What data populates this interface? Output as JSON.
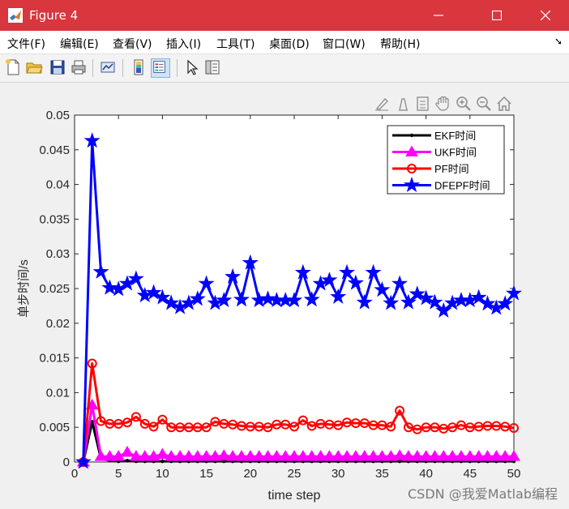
{
  "window": {
    "title": "Figure 4",
    "accent": "#d9363e",
    "controls": [
      "minimize-icon",
      "maximize-icon",
      "close-icon"
    ]
  },
  "menu": [
    "文件(F)",
    "编辑(E)",
    "查看(V)",
    "插入(I)",
    "工具(T)",
    "桌面(D)",
    "窗口(W)",
    "帮助(H)"
  ],
  "toolbar": {
    "icons": [
      "new-figure-icon",
      "open-file-icon",
      "save-icon",
      "print-icon",
      "link-plot-icon",
      "colorbar-icon",
      "legend-icon",
      "pointer-icon",
      "property-inspector-icon"
    ],
    "pressed": [
      "legend-icon"
    ]
  },
  "axes_toolbar": [
    "brush-icon",
    "data-cursor-icon",
    "edit-icon",
    "pan-icon",
    "zoom-in-icon",
    "zoom-out-icon",
    "home-icon"
  ],
  "chart_data": {
    "type": "line",
    "xlabel": "time step",
    "ylabel": "单步时间/s",
    "xlim": [
      0,
      50
    ],
    "ylim": [
      0,
      0.05
    ],
    "xticks": [
      "0",
      "5",
      "10",
      "15",
      "20",
      "25",
      "30",
      "35",
      "40",
      "45",
      "50"
    ],
    "yticks": [
      "0",
      "0.005",
      "0.01",
      "0.015",
      "0.02",
      "0.025",
      "0.03",
      "0.035",
      "0.04",
      "0.045",
      "0.05"
    ],
    "legend_position": "top-right",
    "grid": false,
    "x": [
      1,
      2,
      3,
      4,
      5,
      6,
      7,
      8,
      9,
      10,
      11,
      12,
      13,
      14,
      15,
      16,
      17,
      18,
      19,
      20,
      21,
      22,
      23,
      24,
      25,
      26,
      27,
      28,
      29,
      30,
      31,
      32,
      33,
      34,
      35,
      36,
      37,
      38,
      39,
      40,
      41,
      42,
      43,
      44,
      45,
      46,
      47,
      48,
      49,
      50
    ],
    "series": [
      {
        "name": "EKF时间",
        "color": "#000000",
        "marker": "dot",
        "values": [
          0,
          0.0058,
          0.0005,
          0.0002,
          0.0001,
          0.0002,
          0.0001,
          0.0001,
          0.0001,
          0.0001,
          0.0001,
          0.0001,
          0.0001,
          0.0001,
          0.0001,
          0.0001,
          0.0001,
          0.0001,
          0.0001,
          0.0001,
          0.0001,
          0.0001,
          0.0001,
          0.0001,
          0.0001,
          0.0001,
          0.0001,
          0.0001,
          0.0001,
          0.0001,
          0.0001,
          0.0001,
          0.0001,
          0.0001,
          0.0001,
          0.0001,
          0.0001,
          0.0001,
          0.0001,
          0.0001,
          0.0001,
          0.0001,
          0.0001,
          0.0001,
          0.0001,
          0.0001,
          0.0001,
          0.0001,
          0.0001,
          0.0001
        ]
      },
      {
        "name": "UKF时间",
        "color": "#ff00ff",
        "marker": "triangle",
        "values": [
          0,
          0.0082,
          0.0008,
          0.0008,
          0.0008,
          0.0014,
          0.0008,
          0.0008,
          0.0008,
          0.0011,
          0.0008,
          0.0008,
          0.0008,
          0.0008,
          0.0008,
          0.0008,
          0.0009,
          0.0008,
          0.0008,
          0.0008,
          0.0008,
          0.0008,
          0.0008,
          0.0008,
          0.0008,
          0.0008,
          0.0008,
          0.0008,
          0.0008,
          0.0008,
          0.0008,
          0.0008,
          0.0008,
          0.0008,
          0.0008,
          0.0008,
          0.0009,
          0.0008,
          0.0008,
          0.0008,
          0.0008,
          0.0008,
          0.0008,
          0.0008,
          0.0008,
          0.0008,
          0.0008,
          0.0008,
          0.0008,
          0.0008
        ]
      },
      {
        "name": "PF时间",
        "color": "#ff0000",
        "marker": "circle",
        "values": [
          0,
          0.0142,
          0.0059,
          0.0055,
          0.0055,
          0.0057,
          0.0065,
          0.0055,
          0.0051,
          0.0061,
          0.005,
          0.005,
          0.005,
          0.005,
          0.005,
          0.0058,
          0.0055,
          0.0054,
          0.0052,
          0.0051,
          0.0051,
          0.005,
          0.0054,
          0.0054,
          0.0051,
          0.006,
          0.0052,
          0.0055,
          0.0054,
          0.0053,
          0.0057,
          0.0056,
          0.0056,
          0.0053,
          0.0053,
          0.0051,
          0.0074,
          0.005,
          0.0047,
          0.005,
          0.005,
          0.0048,
          0.005,
          0.0053,
          0.005,
          0.0051,
          0.0052,
          0.0052,
          0.0051,
          0.0049
        ]
      },
      {
        "name": "DFEPF时间",
        "color": "#0000ff",
        "marker": "star",
        "values": [
          0,
          0.0463,
          0.0274,
          0.0251,
          0.0249,
          0.0257,
          0.0264,
          0.024,
          0.0244,
          0.0237,
          0.0229,
          0.0223,
          0.0229,
          0.0235,
          0.0257,
          0.0229,
          0.0233,
          0.0267,
          0.0234,
          0.0287,
          0.0233,
          0.0235,
          0.0233,
          0.0233,
          0.0233,
          0.0273,
          0.0234,
          0.0257,
          0.0262,
          0.0238,
          0.0273,
          0.0258,
          0.023,
          0.0273,
          0.0248,
          0.0229,
          0.0257,
          0.023,
          0.0242,
          0.0236,
          0.023,
          0.0218,
          0.0229,
          0.0233,
          0.0233,
          0.0237,
          0.0228,
          0.0222,
          0.0228,
          0.0243
        ]
      }
    ]
  },
  "watermark": "CSDN @我爱Matlab编程"
}
